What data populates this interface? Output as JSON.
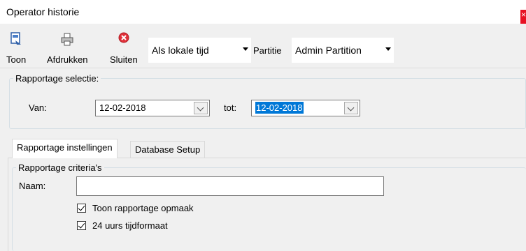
{
  "window": {
    "title": "Operator historie",
    "close_label": "×"
  },
  "toolbar": {
    "show_label": "Toon",
    "print_label": "Afdrukken",
    "close_label": "Sluiten",
    "time_select_value": "Als lokale tijd",
    "partition_label": "Partitie",
    "partition_select_value": "Admin Partition"
  },
  "report_selection": {
    "legend": "Rapportage selectie:",
    "from_label": "Van:",
    "from_value": "12-02-2018",
    "to_label": "tot:",
    "to_value": "12-02-2018"
  },
  "tabs": [
    {
      "label": "Rapportage instellingen",
      "active": true
    },
    {
      "label": "Database Setup",
      "active": false
    }
  ],
  "criteria": {
    "legend": "Rapportage criteria's",
    "name_label": "Naam:",
    "name_value": "",
    "checkboxes": [
      {
        "label": "Toon rapportage opmaak",
        "checked": true
      },
      {
        "label": "24 uurs tijdformaat",
        "checked": true
      }
    ]
  },
  "colors": {
    "selection": "#0078d7",
    "close": "#e81123",
    "icon_red": "#e0303a"
  }
}
